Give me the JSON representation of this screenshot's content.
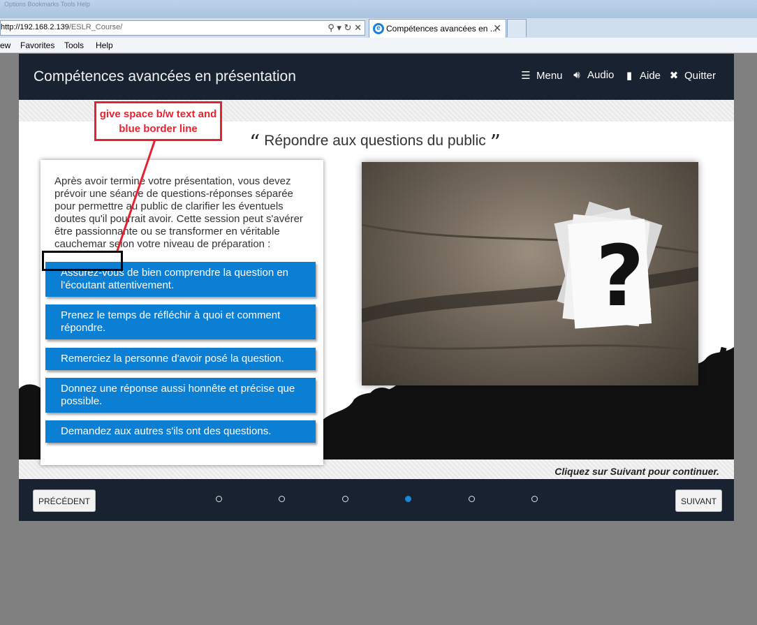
{
  "browser": {
    "faded_bar_text": "Options  Bookmarks  Tools  Help",
    "url_host": "http://192.168.2.139",
    "url_path": "/ESLR_Course/",
    "tab_title": "Compétences avancées en ...",
    "menu": [
      "ew",
      "Favorites",
      "Tools",
      "Help"
    ]
  },
  "course": {
    "title": "Compétences avancées en présentation",
    "nav": [
      {
        "label": "Menu",
        "icon": "list-icon"
      },
      {
        "label": "Audio",
        "icon": "speaker-icon"
      },
      {
        "label": "Aide",
        "icon": "book-icon"
      },
      {
        "label": "Quitter",
        "icon": "close-icon"
      }
    ],
    "slide_title": "Répondre aux questions du public",
    "intro_text": "Après avoir terminé votre présentation, vous devez prévoir une séance de questions-réponses séparée pour permettre au public de clarifier les éventuels doutes qu'il pourrait avoir. Cette session peut s'avérer être passionnante ou se transformer en véritable cauchemar selon votre niveau de préparation :",
    "tips": [
      "Assurez-vous de bien comprendre la question en l'écoutant attentivement.",
      "Prenez le temps de réfléchir à quoi et comment répondre.",
      "Remerciez la personne d'avoir posé la question.",
      "Donnez une réponse aussi honnête et précise que possible.",
      "Demandez aux autres s'ils ont des questions."
    ],
    "footer_hint": "Cliquez sur Suivant pour continuer.",
    "prev_label": "PRÉCÉDENT",
    "next_label": "SUIVANT",
    "pages_total": 6,
    "current_page": 4,
    "accent_color": "#0b7fd3",
    "header_color": "#192230"
  },
  "annotation": {
    "note": "give space b/w text and blue border line",
    "color": "#e42232"
  }
}
